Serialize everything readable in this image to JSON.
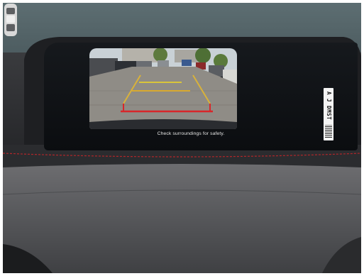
{
  "screen": {
    "caption": "Check surroundings for safety."
  },
  "vehicle_icon": "car-top-view-icon",
  "dealer_sticker": {
    "text": "A J  DMST"
  },
  "colors": {
    "guideline_near": "#d8262a",
    "guideline_mid": "#d8a92f",
    "guideline_far": "#d9c53a",
    "stitching": "#b2262a"
  }
}
